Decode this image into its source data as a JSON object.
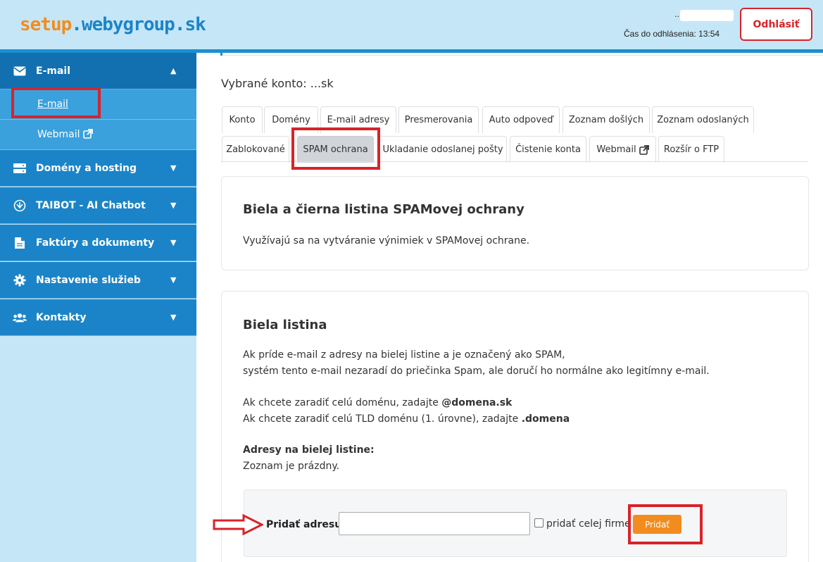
{
  "header": {
    "logo_part1": "setup",
    "logo_part2": ".webygroup.sk",
    "user_name": "...",
    "logout_timer": "Čas do odhlásenia: 13:54",
    "logout_button": "Odhlásiť"
  },
  "sidebar": {
    "items": [
      {
        "label": "E-mail",
        "icon": "envelope-icon",
        "caret": "▲"
      },
      {
        "label": "Domény a hosting",
        "icon": "server-icon",
        "caret": "▼"
      },
      {
        "label": "TAIBOT - AI Chatbot",
        "icon": "chatbot-icon",
        "caret": "▼"
      },
      {
        "label": "Faktúry a dokumenty",
        "icon": "document-icon",
        "caret": "▼"
      },
      {
        "label": "Nastavenie služieb",
        "icon": "gear-icon",
        "caret": "▼"
      },
      {
        "label": "Kontakty",
        "icon": "users-icon",
        "caret": "▼"
      }
    ],
    "sub_items": [
      {
        "label": "E-mail"
      },
      {
        "label": "Webmail"
      }
    ]
  },
  "main": {
    "selected_account_label": "Vybrané konto:",
    "selected_account_value": "...sk",
    "tabs": [
      {
        "label": "Konto"
      },
      {
        "label": "Domény"
      },
      {
        "label": "E-mail adresy"
      },
      {
        "label": "Presmerovania"
      },
      {
        "label": "Auto odpoveď"
      },
      {
        "label": "Zoznam došlých"
      },
      {
        "label": "Zoznam odoslaných"
      },
      {
        "label": "Zablokované"
      },
      {
        "label": "SPAM ochrana"
      },
      {
        "label": "Ukladanie odoslanej pošty"
      },
      {
        "label": "Čistenie konta"
      },
      {
        "label": "Webmail"
      },
      {
        "label": "Rozšír o FTP"
      }
    ],
    "spam_card": {
      "title": "Biela a čierna listina SPAMovej ochrany",
      "text": "Využívajú sa na vytváranie výnimiek v SPAMovej ochrane."
    },
    "whitelist_card": {
      "title": "Biela listina",
      "line1": "Ak príde e-mail z adresy na bielej listine a je označený ako SPAM,",
      "line2": "systém tento e-mail nezaradí do priečinka Spam, ale doručí ho normálne ako legitímny e-mail.",
      "line3_prefix": "Ak chcete zaradiť celú doménu, zadajte ",
      "line3_bold": "@domena.sk",
      "line4_prefix": "Ak chcete zaradiť celú TLD doménu (1. úrovne), zadajte ",
      "line4_bold": ".domena",
      "addresses_label": "Adresy na bielej listine:",
      "empty_text": "Zoznam je prázdny.",
      "add_label": "Pridať adresu:",
      "add_input_value": "",
      "checkbox_label": "pridať celej firme",
      "add_button": "Pridať"
    }
  },
  "colors": {
    "brand_blue": "#1b84c8",
    "brand_orange": "#f28c1e",
    "highlight_red": "#d8232a"
  }
}
